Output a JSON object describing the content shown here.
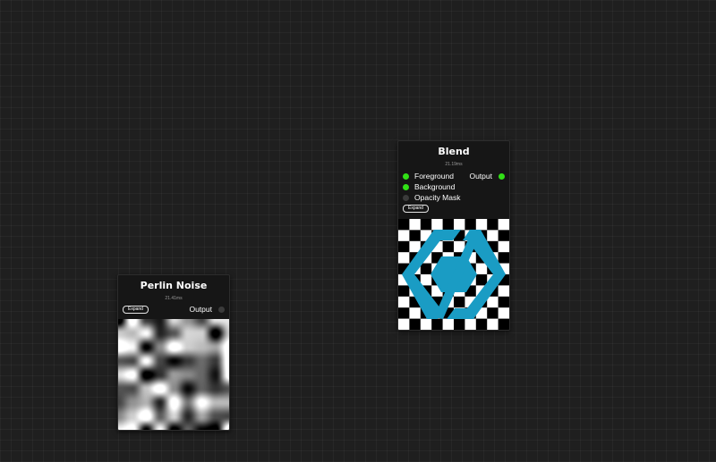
{
  "nodes": {
    "perlin": {
      "title": "Perlin Noise",
      "time": "21.41ms",
      "expand_label": "Expand",
      "output_label": "Output"
    },
    "blend": {
      "title": "Blend",
      "time": "21.19ms",
      "expand_label": "Expand",
      "inputs": [
        {
          "label": "Foreground",
          "connected": true
        },
        {
          "label": "Background",
          "connected": true
        },
        {
          "label": "Opacity Mask",
          "connected": false
        }
      ],
      "output_label": "Output"
    }
  },
  "colors": {
    "port_connected": "#31e016",
    "port_disconnected": "#3b3b3b",
    "logo_blue": "#1a9cc4"
  },
  "icons": {
    "blend_preview_logo": "hexagon-chevrons-logo-icon"
  }
}
